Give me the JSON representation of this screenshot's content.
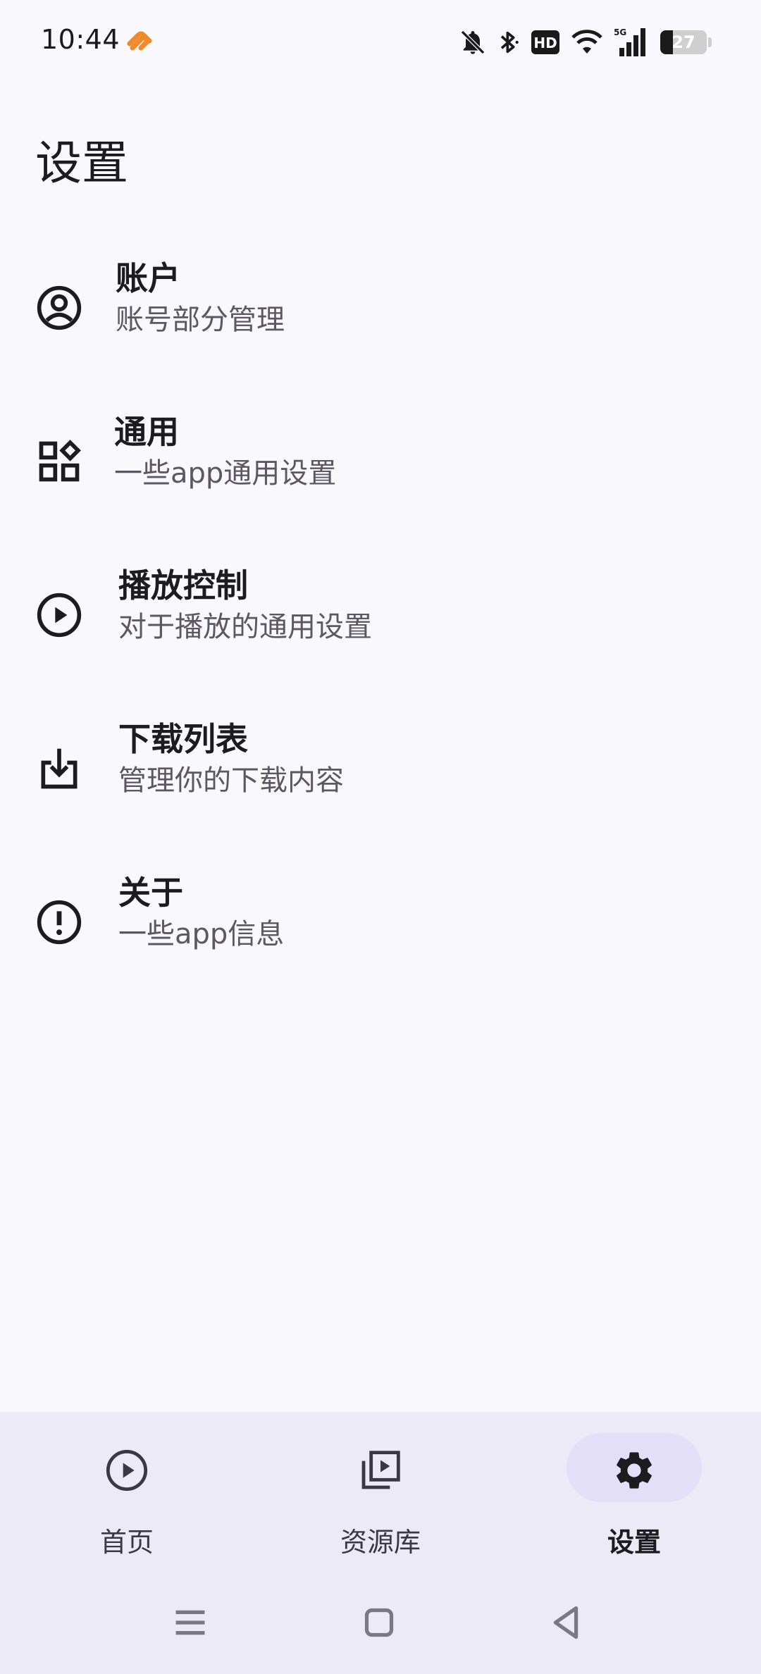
{
  "status_bar": {
    "time": "10:44",
    "app_icon": "orange-heart-app-icon",
    "icons": [
      "bell-off-icon",
      "bluetooth-icon",
      "hd-icon",
      "wifi-icon",
      "signal-5g-icon"
    ],
    "network_label": "5G",
    "hd_label": "HD",
    "battery_level": "27",
    "battery_fraction": 0.27
  },
  "page": {
    "title": "设置"
  },
  "settings": {
    "items": [
      {
        "title": "账户",
        "subtitle": "账号部分管理",
        "icon": "account-circle-icon"
      },
      {
        "title": "通用",
        "subtitle": "一些app通用设置",
        "icon": "widgets-icon"
      },
      {
        "title": "播放控制",
        "subtitle": "对于播放的通用设置",
        "icon": "play-circle-icon"
      },
      {
        "title": "下载列表",
        "subtitle": "管理你的下载内容",
        "icon": "download-icon"
      },
      {
        "title": "关于",
        "subtitle": "一些app信息",
        "icon": "info-circle-icon"
      }
    ]
  },
  "bottom_nav": {
    "items": [
      {
        "label": "首页",
        "icon": "play-circle-icon",
        "active": false
      },
      {
        "label": "资源库",
        "icon": "video-library-icon",
        "active": false
      },
      {
        "label": "设置",
        "icon": "gear-icon",
        "active": true
      }
    ]
  },
  "system_nav": {
    "buttons": [
      "menu-icon",
      "home-icon",
      "back-icon"
    ]
  },
  "colors": {
    "background": "#f9f8fd",
    "nav_background": "#eceaf6",
    "active_pill": "#e3dff9",
    "app_icon_orange": "#f08a2c"
  }
}
